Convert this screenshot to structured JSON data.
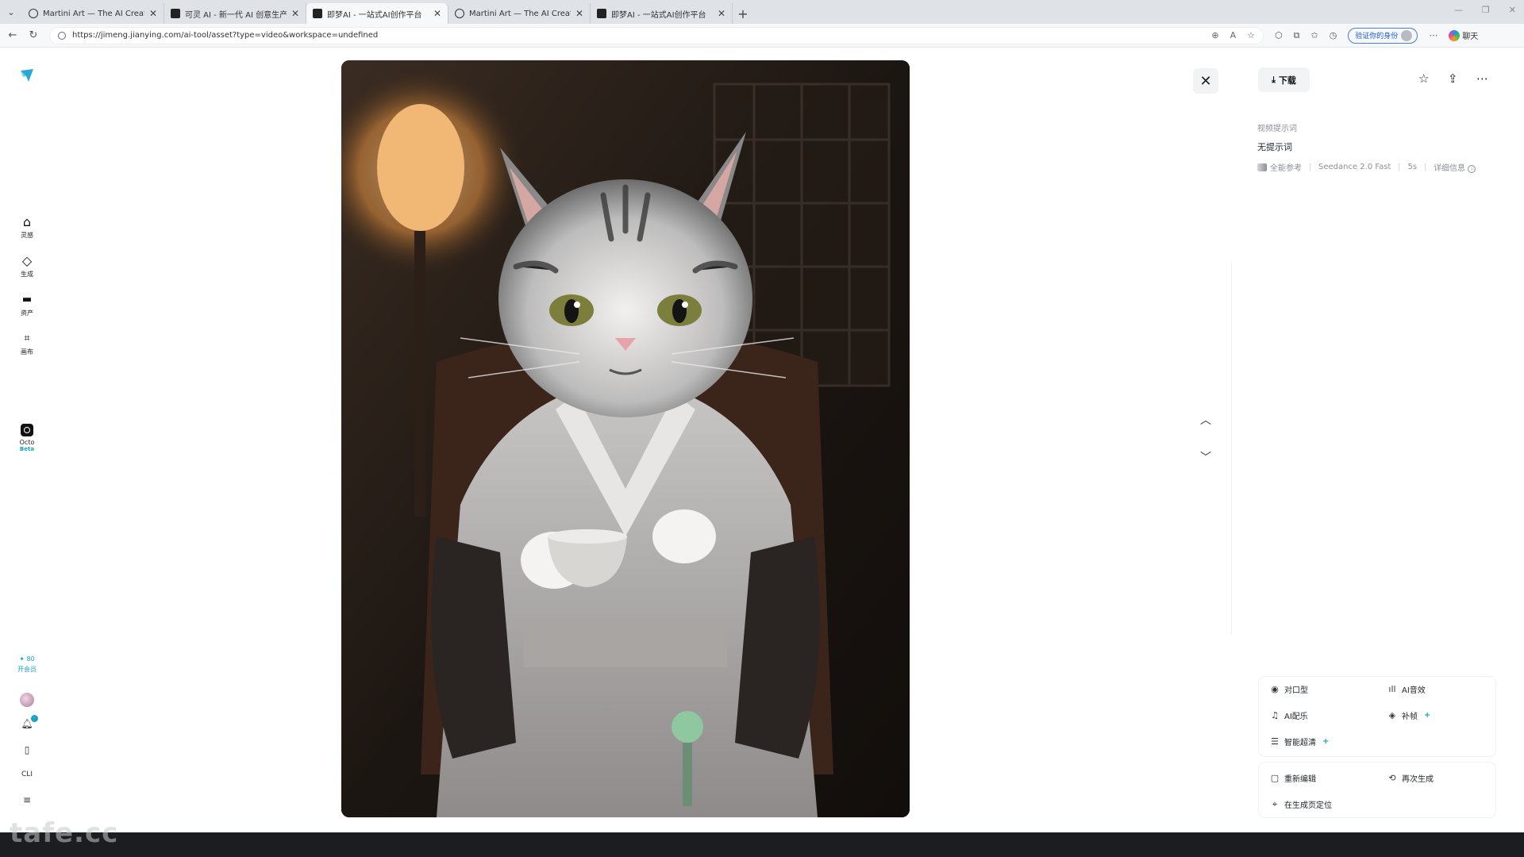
{
  "browser": {
    "tabs": [
      {
        "title": "Martini Art — The AI Creative Can",
        "icon": "circle-icon"
      },
      {
        "title": "可灵 AI - 新一代 AI 创意生产力平台",
        "icon": "square-icon"
      },
      {
        "title": "即梦AI - 一站式AI创作平台",
        "icon": "square-icon"
      },
      {
        "title": "Martini Art — The AI Creative Can",
        "icon": "circle-icon"
      },
      {
        "title": "即梦AI - 一站式AI创作平台",
        "icon": "square-icon"
      }
    ],
    "active_tab": 2,
    "url": "https://jimeng.jianying.com/ai-tool/asset?type=video&workspace=undefined",
    "profile_label": "验证你的身份",
    "copilot_label": "聊天"
  },
  "sidebar": {
    "items": [
      {
        "label": "灵感",
        "icon": "home-icon"
      },
      {
        "label": "生成",
        "icon": "diamond-icon"
      },
      {
        "label": "资产",
        "icon": "folder-icon"
      },
      {
        "label": "画布",
        "icon": "canvas-icon"
      }
    ],
    "octo": {
      "label": "Octo",
      "badge": "Beta"
    },
    "points": "80",
    "vip_label": "开会员",
    "api_label": "CLI"
  },
  "right_panel": {
    "download_label": "下载",
    "prompt_label": "视频提示词",
    "prompt_text": "无提示词",
    "meta": {
      "reference": "全能参考",
      "model": "Seedance 2.0 Fast",
      "duration": "5s",
      "details": "详细信息"
    },
    "tools": [
      {
        "label": "对口型",
        "icon": "lips-icon",
        "plus": false
      },
      {
        "label": "AI音效",
        "icon": "waveform-icon",
        "plus": false
      },
      {
        "label": "AI配乐",
        "icon": "music-icon",
        "plus": false
      },
      {
        "label": "补帧",
        "icon": "frames-icon",
        "plus": true
      },
      {
        "label": "智能超清",
        "icon": "enhance-icon",
        "plus": true
      }
    ],
    "tools2": [
      {
        "label": "重新编辑",
        "icon": "edit-icon"
      },
      {
        "label": "再次生成",
        "icon": "regenerate-icon"
      },
      {
        "label": "在生成页定位",
        "icon": "locate-icon"
      }
    ]
  },
  "watermark": "tafe.cc",
  "colors": {
    "accent": "#16a3c4",
    "taskbar": "#1b1d21"
  }
}
